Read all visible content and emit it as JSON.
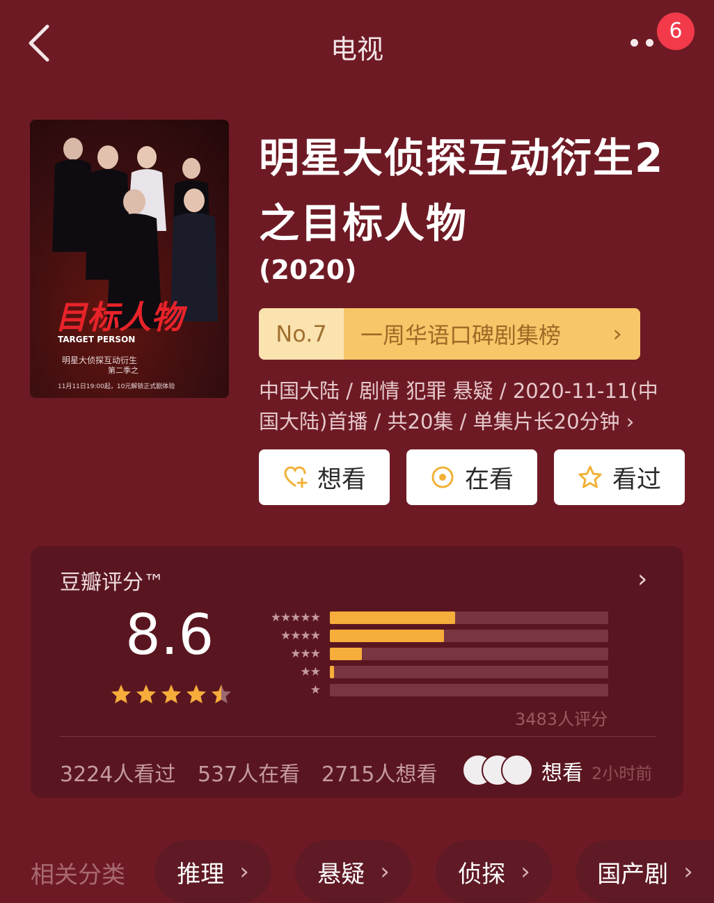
{
  "topbar": {
    "title": "电视",
    "notification_count": "6"
  },
  "poster": {
    "title_art": "目标人物",
    "title_art_en": "TARGET PERSON",
    "subtitle": "明星大侦探互动衍生",
    "series_line": "第二季之",
    "airing_note": "11月11日19:00起，10元解锁正式剧体验"
  },
  "show": {
    "title": "明星大侦探互动衍生2之目标人物",
    "year": "(2020)",
    "rank_no": "No.7",
    "rank_label": "一周华语口碑剧集榜",
    "meta": "中国大陆 / 剧情 犯罪 悬疑 / 2020-11-11(中国大陆)首播 / 共20集 / 单集片长20分钟"
  },
  "actions": [
    {
      "label": "想看",
      "icon": "heart-plus-icon"
    },
    {
      "label": "在看",
      "icon": "target-icon"
    },
    {
      "label": "看过",
      "icon": "star-outline-icon"
    }
  ],
  "rating": {
    "title": "豆瓣评分™",
    "score": "8.6",
    "stars": 4.5,
    "distribution": [
      {
        "stars": 5,
        "fraction": 0.45
      },
      {
        "stars": 4,
        "fraction": 0.41
      },
      {
        "stars": 3,
        "fraction": 0.115
      },
      {
        "stars": 2,
        "fraction": 0.015
      },
      {
        "stars": 1,
        "fraction": 0.0
      }
    ],
    "count_label": "3483人评分",
    "seen": "3224人看过",
    "watching": "537人在看",
    "wish": "2715人想看",
    "friends_label": "想看",
    "friends_time": "2小时前"
  },
  "related": {
    "label": "相关分类",
    "chips": [
      "推理",
      "悬疑",
      "侦探",
      "国产剧"
    ]
  },
  "colors": {
    "background": "#6e1a24",
    "card": "#5a1620",
    "accent": "#f6ad3c"
  }
}
